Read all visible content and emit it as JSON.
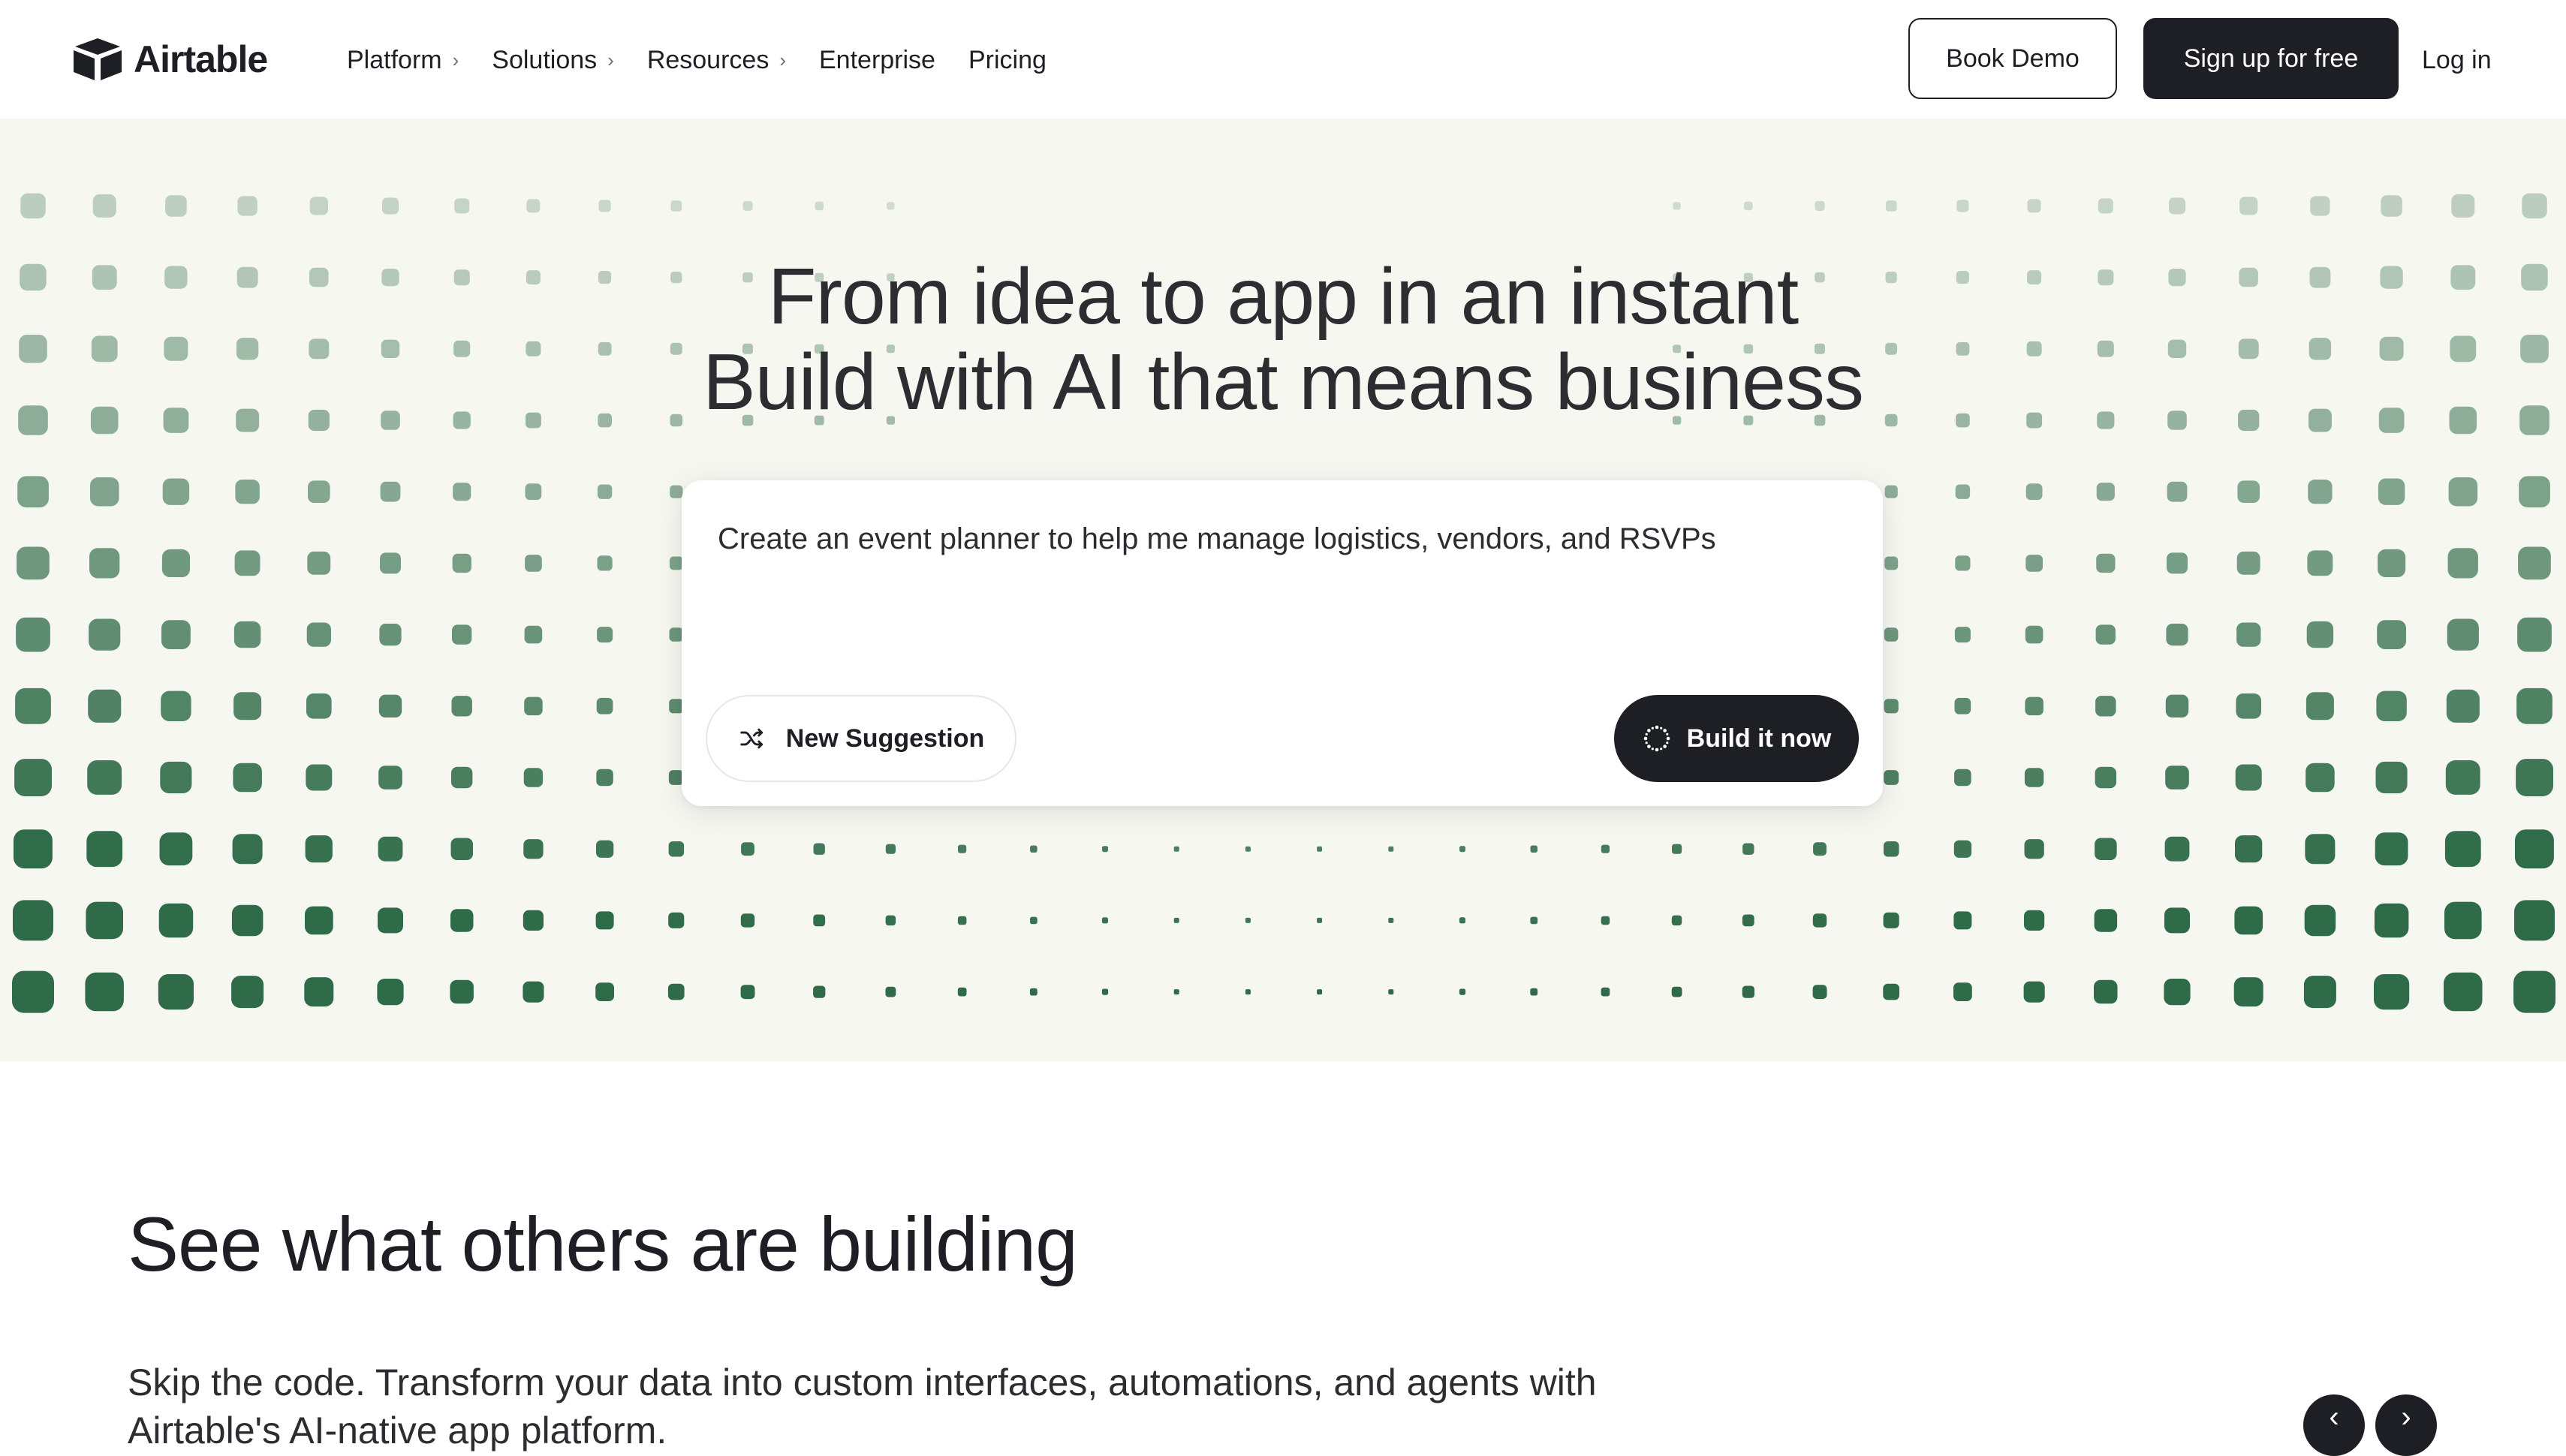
{
  "header": {
    "logo_text": "Airtable",
    "nav": [
      {
        "label": "Platform",
        "has_chevron": true
      },
      {
        "label": "Solutions",
        "has_chevron": true
      },
      {
        "label": "Resources",
        "has_chevron": true
      },
      {
        "label": "Enterprise",
        "has_chevron": false
      },
      {
        "label": "Pricing",
        "has_chevron": false
      }
    ],
    "book_demo": "Book Demo",
    "sign_up": "Sign up for free",
    "log_in": "Log in"
  },
  "hero": {
    "title_line1": "From idea to app in an instant",
    "title_line2": "Build with AI that means business",
    "prompt": "Create an event planner to help me manage logistics, vendors, and RSVPs",
    "new_suggestion": "New Suggestion",
    "build_now": "Build it now"
  },
  "showcase": {
    "title": "See what others are building",
    "subtitle": "Skip the code. Transform your data into custom interfaces, automations, and agents with Airtable's AI-native app platform."
  },
  "colors": {
    "hero_bg": "#f7f7f2",
    "dot_green": "#2f6b48",
    "primary_dark": "#1d1f25"
  },
  "icons": {
    "logo": "airtable-logo-icon",
    "chevron": "chevron-right-icon",
    "shuffle": "shuffle-icon",
    "spinner": "spinner-icon",
    "prev": "chevron-left-icon",
    "next": "chevron-right-icon"
  }
}
